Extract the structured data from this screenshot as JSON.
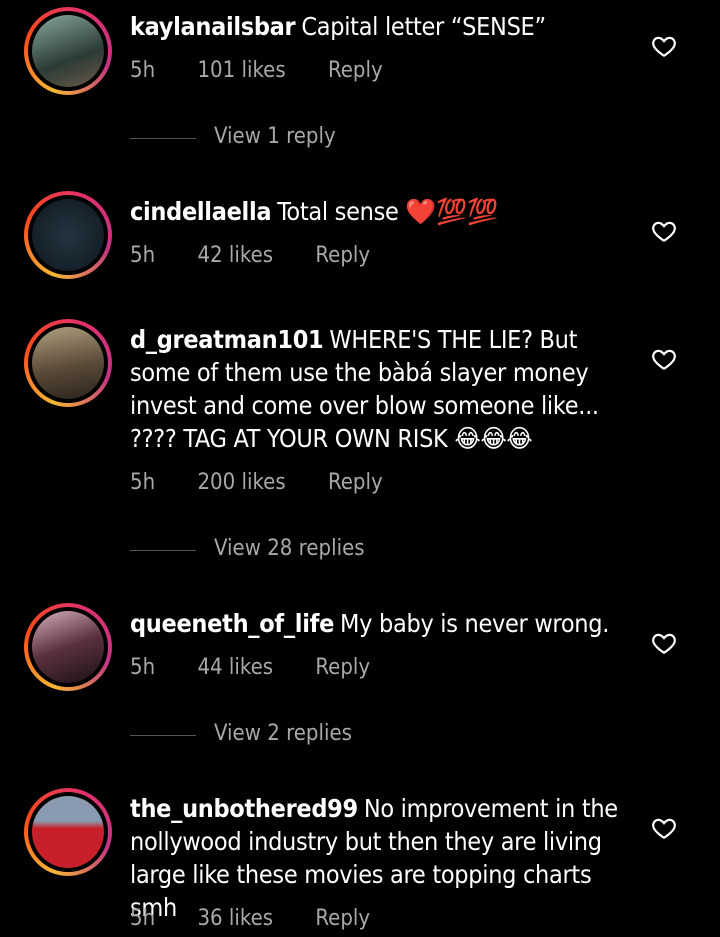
{
  "comments": [
    {
      "username": "kaylanailsbar",
      "text": "Capital letter “SENSE”",
      "time": "5h",
      "likes": "101 likes",
      "reply": "Reply",
      "view_replies": "View 1 reply",
      "avatar_colors": [
        "#5a7a6a",
        "#2b3b35"
      ]
    },
    {
      "username": "cindellaella",
      "text": "Total sense ❤️💯💯",
      "time": "5h",
      "likes": "42 likes",
      "reply": "Reply",
      "avatar_colors": [
        "#1b2a35",
        "#0d1820"
      ]
    },
    {
      "username": "d_greatman101",
      "text": "WHERE'S THE LIE? But some of them use the bàbá slayer money invest and come over blow someone like... ???? TAG AT YOUR OWN RISK 😂😂😂",
      "time": "5h",
      "likes": "200 likes",
      "reply": "Reply",
      "view_replies": "View 28 replies",
      "avatar_colors": [
        "#8a7a5a",
        "#3a3428"
      ]
    },
    {
      "username": "queeneth_of_life",
      "text": "My baby is never wrong.",
      "time": "5h",
      "likes": "44 likes",
      "reply": "Reply",
      "view_replies": "View 2 replies",
      "avatar_colors": [
        "#c48aa0",
        "#3a2028"
      ]
    },
    {
      "username": "the_unbothered99",
      "text": "No improvement in the nollywood industry but then they are living large like these movies are topping charts smh",
      "time": "5h",
      "likes": "36 likes",
      "reply": "Reply",
      "avatar_colors": [
        "#c8202a",
        "#7a8aa0"
      ]
    }
  ]
}
